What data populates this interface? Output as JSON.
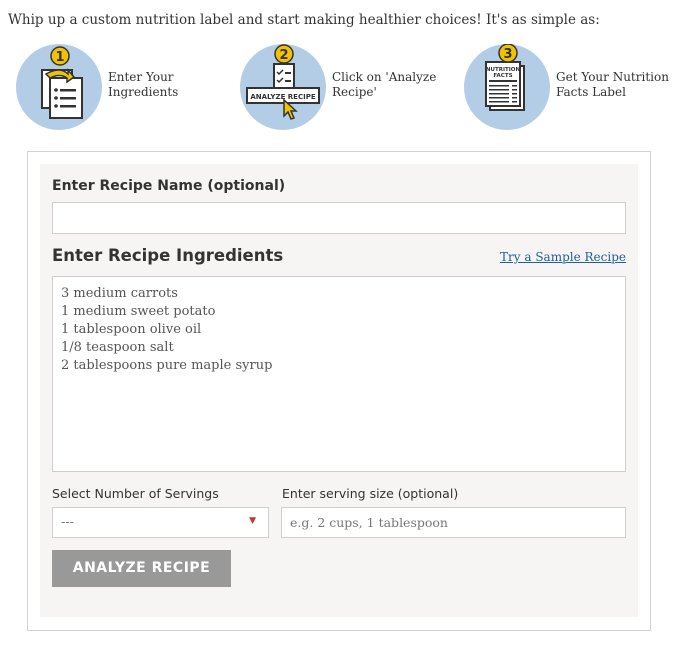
{
  "intro": "Whip up a custom nutrition label and start making healthier choices! It's as simple as:",
  "steps": [
    {
      "number": "1",
      "label_line1": "Enter Your",
      "label_line2": "Ingredients",
      "icon": "document-arrow-icon"
    },
    {
      "number": "2",
      "label_line1": "Click on 'Analyze",
      "label_line2": "Recipe'",
      "icon": "analyze-recipe-icon",
      "button_text": "ANALYZE RECIPE"
    },
    {
      "number": "3",
      "label_line1": "Get Your Nutrition",
      "label_line2": "Facts Label",
      "icon": "nutrition-facts-icon",
      "doc_text_line1": "NUTRITION",
      "doc_text_line2": "FACTS"
    }
  ],
  "form": {
    "recipe_name_heading": "Enter Recipe Name (optional)",
    "recipe_name_value": "",
    "ingredients_heading": "Enter Recipe Ingredients",
    "sample_link": "Try a Sample Recipe",
    "ingredients": [
      "3 medium carrots",
      "1 medium sweet potato",
      "1 tablespoon olive oil",
      "1/8 teaspoon salt",
      "2 tablespoons pure maple syrup"
    ],
    "servings_heading": "Select Number of Servings",
    "servings_value": "---",
    "serving_size_heading": "Enter serving size (optional)",
    "serving_size_placeholder": "e.g. 2 cups, 1 tablespoon",
    "analyze_button": "ANALYZE RECIPE"
  },
  "colors": {
    "circle": "#b3cde6",
    "badge": "#f2c200",
    "panel": "#f6f5f3",
    "button": "#999999",
    "link": "#1f5fa0"
  }
}
